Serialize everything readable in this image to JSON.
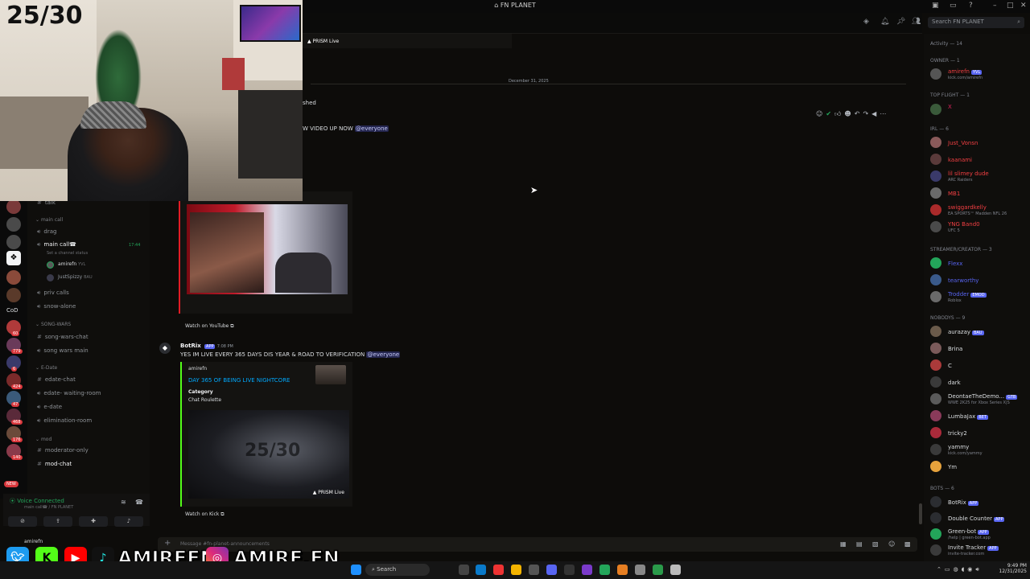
{
  "window": {
    "title": "FN PLANET"
  },
  "search": {
    "placeholder": "Search FN PLANET"
  },
  "date_divider": "December 31, 2025",
  "overlay": {
    "counter": "25/30",
    "watermark": "25/30",
    "handle_1": "AMIREFN",
    "handle_2": "AMIRE.FN"
  },
  "top_embed": {
    "badge": "PRISM Live"
  },
  "msg_partial": {
    "fragment_1": "shed",
    "text": "W VIDEO UP NOW",
    "mention": "@everyone"
  },
  "embed_youtube": {
    "link": "Watch on YouTube"
  },
  "msg_botrix": {
    "author": "BotRix",
    "tag": "APP",
    "time": "7:08 PM",
    "text": "YES IM LIVE EVERY 365 DAYS DIS YEAR & ROAD TO VERIFICATION",
    "mention": "@everyone",
    "embed": {
      "provider": "amirefn",
      "title": "DAY 365 OF BEING LIVE NIGHTCORE",
      "field_name": "Category",
      "field_value": "Chat Roulette",
      "badge": "PRISM Live",
      "link": "Watch on Kick"
    }
  },
  "composer": {
    "placeholder": "Message #fn-planet-announcements"
  },
  "channels": {
    "partial_top": "talk",
    "cat_main": "main call",
    "drag": "drag",
    "main_call": "main call☎",
    "main_call_status": "Set a channel status",
    "main_call_time": "17:44",
    "voice_users": [
      {
        "name": "amirefn",
        "tag": "YVL"
      },
      {
        "name": "JustSpizzy",
        "tag": "BAU"
      }
    ],
    "priv_calls": "priv calls",
    "snow_alone": "snow-alone",
    "cat_song": "SONG-WARS",
    "song_wars_chat": "song-wars-chat",
    "song_wars_main": "song wars main",
    "cat_edate": "E-Date",
    "edate_chat": "edate-chat",
    "edate_waiting": "edate- waiting-room",
    "e_date": "e-date",
    "elimination": "elimination-room",
    "cat_mod": "mod",
    "moderator_only": "moderator-only",
    "mod_chat": "mod-chat"
  },
  "server_rail": {
    "cod_label": "CoD",
    "badges": [
      "60",
      "779",
      "6",
      "424",
      "47",
      "468",
      "176",
      "140"
    ],
    "new_label": "NEW"
  },
  "voice_panel": {
    "status": "Voice Connected",
    "location": "main call☎ / FN PLANET",
    "user": "amirefn"
  },
  "members": {
    "activity": "Activity — 14",
    "cat_owner": "OWNER — 1",
    "owner": {
      "name": "amirefn",
      "tag": "YVL",
      "status": "kick.com/amirefn",
      "color": "#f23f43"
    },
    "cat_topflight": "TOP FLIGHT — 1",
    "topflight": {
      "name": "X",
      "color": "#e0245e"
    },
    "cat_irl": "IRL — 6",
    "irl": [
      {
        "name": "Just_Vonsn",
        "status": "",
        "color": "#f23f43"
      },
      {
        "name": "kaanami",
        "status": "",
        "color": "#f23f43"
      },
      {
        "name": "lil slimey dude",
        "status": "ARC Raiders",
        "color": "#f23f43"
      },
      {
        "name": "MB1",
        "status": "",
        "color": "#f23f43"
      },
      {
        "name": "swiggardkelly",
        "status": "EA SPORTS™ Madden NFL 26",
        "color": "#f23f43"
      },
      {
        "name": "YNG Band0",
        "status": "UFC 5",
        "color": "#f23f43"
      }
    ],
    "cat_streamer": "STREAMER/CREATOR — 3",
    "streamer": [
      {
        "name": "Flexx",
        "status": "",
        "color": "#5865f2"
      },
      {
        "name": "tearworthy",
        "status": "",
        "color": "#5865f2"
      },
      {
        "name": "Trodder",
        "tag": "EMOD",
        "status": "Roblox",
        "color": "#5865f2"
      }
    ],
    "cat_nobodys": "NOBODYS — 9",
    "nobodys": [
      {
        "name": "aurazay",
        "tag": "BAU",
        "status": "",
        "color": "#dbdee1"
      },
      {
        "name": "Brina",
        "status": "",
        "color": "#dbdee1"
      },
      {
        "name": "C",
        "status": "",
        "color": "#dbdee1"
      },
      {
        "name": "dark",
        "status": "",
        "color": "#dbdee1"
      },
      {
        "name": "DeontaeTheDemo...",
        "tag": "GTB",
        "status": "WWE 2K25 for Xbox Series X|S",
        "color": "#dbdee1"
      },
      {
        "name": "LumbaJax",
        "tag": "BET",
        "status": "",
        "color": "#dbdee1"
      },
      {
        "name": "tricky2",
        "status": "",
        "color": "#dbdee1"
      },
      {
        "name": "yammy",
        "status": "kick.com/yammy",
        "color": "#dbdee1"
      },
      {
        "name": "Ym",
        "status": "",
        "color": "#dbdee1"
      }
    ],
    "cat_bots": "BOTS — 6",
    "bots": [
      {
        "name": "BotRix",
        "tag": "APP",
        "status": "",
        "color": "#dbdee1"
      },
      {
        "name": "Double Counter",
        "tag": "APP",
        "status": "",
        "color": "#dbdee1"
      },
      {
        "name": "Green-bot",
        "tag": "APP",
        "status": "/help | green-bot.app",
        "color": "#dbdee1"
      },
      {
        "name": "Invite Tracker",
        "tag": "APP",
        "status": "invite-tracker.com",
        "color": "#dbdee1"
      }
    ]
  },
  "taskbar": {
    "search": "Search",
    "time": "9:49 PM",
    "date": "12/31/2025"
  }
}
